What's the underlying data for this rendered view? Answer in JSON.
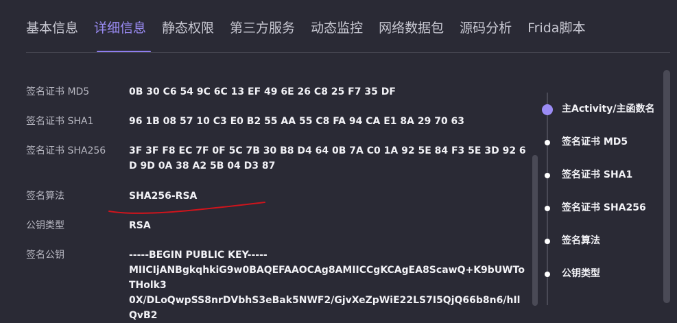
{
  "tabs": [
    {
      "label": "基本信息"
    },
    {
      "label": "详细信息"
    },
    {
      "label": "静态权限"
    },
    {
      "label": "第三方服务"
    },
    {
      "label": "动态监控"
    },
    {
      "label": "网络数据包"
    },
    {
      "label": "源码分析"
    },
    {
      "label": "Frida脚本"
    }
  ],
  "active_tab": "详细信息",
  "details": {
    "md5": {
      "label": "签名证书 MD5",
      "value": "0B 30 C6 54 9C 6C 13 EF 49 6E 26 C8 25 F7 35 DF"
    },
    "sha1": {
      "label": "签名证书 SHA1",
      "value": "96 1B 08 57 10 C3 E0 B2 55 AA 55 C8 FA 94 CA E1 8A 29 70 63"
    },
    "sha256": {
      "label": "签名证书 SHA256",
      "value": "3F 3F F8 EC 7F 0F 5C 7B 30 B8 D4 64 0B 7A C0 1A 92 5E 84 F3 5E 3D 92 6D 9D 0A 38 A2 5B 04 D3 87"
    },
    "algorithm": {
      "label": "签名算法",
      "value": "SHA256-RSA"
    },
    "key_type": {
      "label": "公钥类型",
      "value": "RSA"
    },
    "public_key": {
      "label": "签名公钥",
      "line1": "-----BEGIN PUBLIC KEY-----",
      "line2": "MIICIjANBgkqhkiG9w0BAQEFAAOCAg8AMIICCgKCAgEA8ScawQ+K9bUWToTHolk3",
      "line3": "0X/DLoQwpSS8nrDVbhS3eBak5NWF2/GjvXeZpWiE22LS7I5QjQ66b8n6/hIlQvB2"
    }
  },
  "anchors": [
    {
      "label": "主Activity/主函数名"
    },
    {
      "label": "签名证书 MD5"
    },
    {
      "label": "签名证书 SHA1"
    },
    {
      "label": "签名证书 SHA256"
    },
    {
      "label": "签名算法"
    },
    {
      "label": "公钥类型"
    }
  ],
  "colors": {
    "background": "#2a2a35",
    "accent": "#9b8cf5",
    "annotation": "#d0141c"
  }
}
